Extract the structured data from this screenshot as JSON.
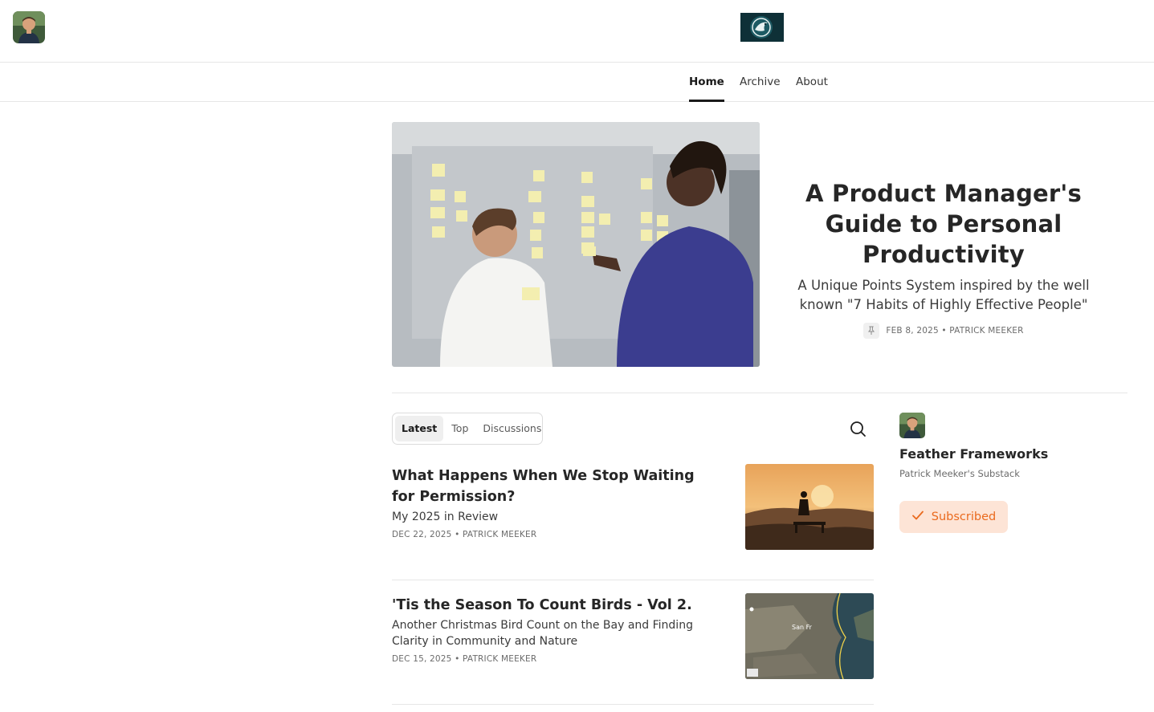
{
  "header": {
    "author_avatar": "author-avatar",
    "publication_logo": "publication-logo"
  },
  "nav": {
    "items": [
      {
        "label": "Home",
        "active": true
      },
      {
        "label": "Archive",
        "active": false
      },
      {
        "label": "About",
        "active": false
      }
    ]
  },
  "hero": {
    "title": "A Product Manager's Guide to Personal Productivity",
    "subtitle": "A Unique Points System inspired by the well known \"7 Habits of Highly Effective People\"",
    "meta": "FEB 8, 2025 • PATRICK MEEKER",
    "pin_icon": "pin-icon"
  },
  "tabs": {
    "items": [
      "Latest",
      "Top",
      "Discussions"
    ],
    "active": "Latest",
    "search_icon": "search-icon"
  },
  "posts": [
    {
      "title": "What Happens When We Stop Waiting for Permission?",
      "subtitle": "My 2025 in Review",
      "meta": "DEC 22, 2025 • PATRICK MEEKER"
    },
    {
      "title": "'Tis the Season To Count Birds - Vol 2.",
      "subtitle": "Another Christmas Bird Count on the Bay and Finding Clarity in Community and Nature",
      "meta": "DEC 15, 2025 • PATRICK MEEKER"
    }
  ],
  "sidebar": {
    "publication_name": "Feather Frameworks",
    "description": "Patrick Meeker's Substack",
    "subscribe_label": "Subscribed",
    "check_icon": "check-icon"
  },
  "colors": {
    "accent": "#ea6a1e",
    "accent_bg": "#fde4d6",
    "text": "#262626",
    "muted": "#6b6b6b",
    "divider": "#e6e6e6"
  }
}
